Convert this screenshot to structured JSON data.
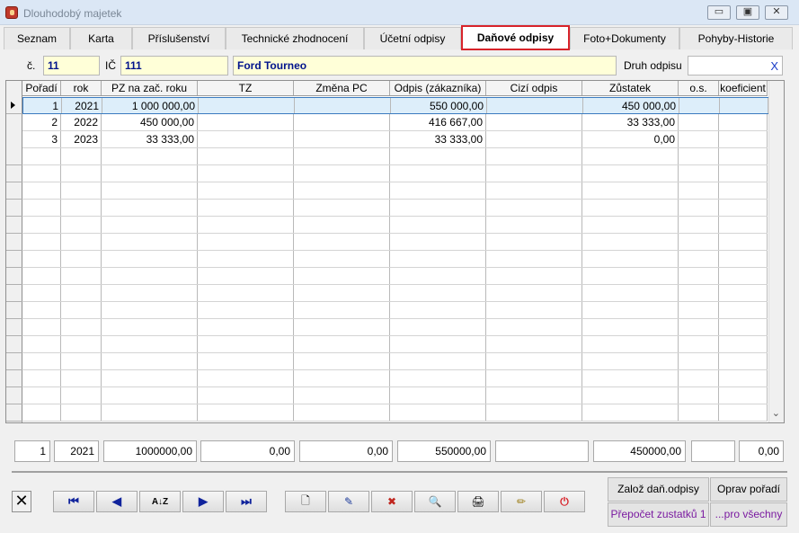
{
  "window": {
    "title": "Dlouhodobý majetek",
    "minimize_glyph": "▭",
    "maximize_glyph": "▣",
    "close_glyph": "✕"
  },
  "tabs": [
    {
      "label": "Seznam"
    },
    {
      "label": "Karta"
    },
    {
      "label": "Příslušenství"
    },
    {
      "label": "Technické zhodnocení"
    },
    {
      "label": "Účetní odpisy"
    },
    {
      "label": "Daňové odpisy"
    },
    {
      "label": "Foto+Dokumenty"
    },
    {
      "label": "Pohyby-Historie"
    }
  ],
  "header": {
    "c_label": "č.",
    "c_value": "11",
    "ic_label": "IČ",
    "ic_value": "111",
    "name_value": "Ford Tourneo",
    "druh_label": "Druh odpisu",
    "druh_value": "",
    "druh_clear": "X"
  },
  "table": {
    "columns": [
      "Pořadí",
      "rok",
      "PZ na zač. roku",
      "TZ",
      "Změna PC",
      "Odpis (zákazníka)",
      "Cizí odpis",
      "Zůstatek",
      "o.s.",
      "koeficient"
    ],
    "rows": [
      [
        "1",
        "2021",
        "1 000 000,00",
        "",
        "",
        "550 000,00",
        "",
        "450 000,00",
        "",
        ""
      ],
      [
        "2",
        "2022",
        "450 000,00",
        "",
        "",
        "416 667,00",
        "",
        "33 333,00",
        "",
        ""
      ],
      [
        "3",
        "2023",
        "33 333,00",
        "",
        "",
        "33 333,00",
        "",
        "0,00",
        "",
        ""
      ]
    ]
  },
  "detail": {
    "poradi": "1",
    "rok": "2021",
    "pz": "1000000,00",
    "tz": "0,00",
    "zmena_pc": "0,00",
    "odpis": "550000,00",
    "cizi": "",
    "zustatek": "450000,00",
    "os": "",
    "koeficient": "0,00"
  },
  "toolbar": {
    "close_glyph": "✕",
    "first_glyph": "⏮",
    "prev_glyph": "◀",
    "sort_glyph": "A↓Z",
    "next_glyph": "▶",
    "last_glyph": "⏭",
    "new_glyph": "🗋",
    "edit_glyph": "✎",
    "delete_glyph": "✖",
    "search_glyph": "🔍",
    "print_glyph": "🖨",
    "tools_glyph": "✏",
    "power_glyph": "⏻"
  },
  "actions": {
    "zaloz": "Založ daň.odpisy",
    "oprav": "Oprav pořadí",
    "prepocet": "Přepočet zustatků 1",
    "pro_vsechny": "...pro všechny"
  },
  "colors": {
    "active_tab_border": "#d8232a",
    "field_bg": "#ffffd8",
    "selection": "#ddeefa",
    "purple_text": "#7a1aa0"
  }
}
